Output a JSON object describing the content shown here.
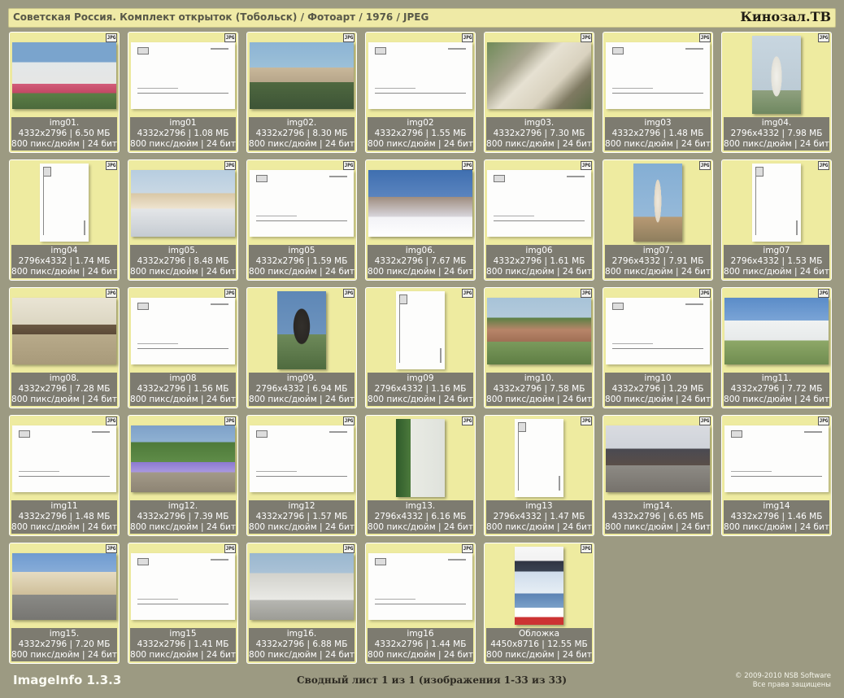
{
  "header": {
    "title": "Советская Россия. Комплект открыток (Тобольск) / Фотоарт / 1976 / JPEG",
    "brand": "Кинозал.ТВ"
  },
  "badge_label": "JPG",
  "tiles": [
    {
      "name": "img01.",
      "dims": "4332x2796 | 6.50 МБ",
      "dpi": "800 пикс/дюйм | 24 бит",
      "orientation": "land",
      "kind": "photo",
      "style": "p-img01"
    },
    {
      "name": "img01",
      "dims": "4332x2796 | 1.08 МБ",
      "dpi": "800 пикс/дюйм | 24 бит",
      "orientation": "land",
      "kind": "back",
      "style": ""
    },
    {
      "name": "img02.",
      "dims": "4332x2796 | 8.30 МБ",
      "dpi": "800 пикс/дюйм | 24 бит",
      "orientation": "land",
      "kind": "photo",
      "style": "p-img02"
    },
    {
      "name": "img02",
      "dims": "4332x2796 | 1.55 МБ",
      "dpi": "800 пикс/дюйм | 24 бит",
      "orientation": "land",
      "kind": "back",
      "style": ""
    },
    {
      "name": "img03.",
      "dims": "4332x2796 | 7.30 МБ",
      "dpi": "800 пикс/дюйм | 24 бит",
      "orientation": "land",
      "kind": "photo",
      "style": "p-img03"
    },
    {
      "name": "img03",
      "dims": "4332x2796 | 1.48 МБ",
      "dpi": "800 пикс/дюйм | 24 бит",
      "orientation": "land",
      "kind": "back",
      "style": ""
    },
    {
      "name": "img04.",
      "dims": "2796x4332 | 7.98 МБ",
      "dpi": "800 пикс/дюйм | 24 бит",
      "orientation": "port",
      "kind": "photo",
      "style": "p-img04"
    },
    {
      "name": "img04",
      "dims": "2796x4332 | 1.74 МБ",
      "dpi": "800 пикс/дюйм | 24 бит",
      "orientation": "port",
      "kind": "back",
      "style": ""
    },
    {
      "name": "img05.",
      "dims": "4332x2796 | 8.48 МБ",
      "dpi": "800 пикс/дюйм | 24 бит",
      "orientation": "land",
      "kind": "photo",
      "style": "p-img05"
    },
    {
      "name": "img05",
      "dims": "4332x2796 | 1.59 МБ",
      "dpi": "800 пикс/дюйм | 24 бит",
      "orientation": "land",
      "kind": "back",
      "style": ""
    },
    {
      "name": "img06.",
      "dims": "4332x2796 | 7.67 МБ",
      "dpi": "800 пикс/дюйм | 24 бит",
      "orientation": "land",
      "kind": "photo",
      "style": "p-img06"
    },
    {
      "name": "img06",
      "dims": "4332x2796 | 1.61 МБ",
      "dpi": "800 пикс/дюйм | 24 бит",
      "orientation": "land",
      "kind": "back",
      "style": ""
    },
    {
      "name": "img07.",
      "dims": "2796x4332 | 7.91 МБ",
      "dpi": "800 пикс/дюйм | 24 бит",
      "orientation": "port",
      "kind": "photo",
      "style": "p-img07"
    },
    {
      "name": "img07",
      "dims": "2796x4332 | 1.53 МБ",
      "dpi": "800 пикс/дюйм | 24 бит",
      "orientation": "port",
      "kind": "back",
      "style": ""
    },
    {
      "name": "img08.",
      "dims": "4332x2796 | 7.28 МБ",
      "dpi": "800 пикс/дюйм | 24 бит",
      "orientation": "land",
      "kind": "photo",
      "style": "p-img08"
    },
    {
      "name": "img08",
      "dims": "4332x2796 | 1.56 МБ",
      "dpi": "800 пикс/дюйм | 24 бит",
      "orientation": "land",
      "kind": "back",
      "style": ""
    },
    {
      "name": "img09.",
      "dims": "2796x4332 | 6.94 МБ",
      "dpi": "800 пикс/дюйм | 24 бит",
      "orientation": "port",
      "kind": "photo",
      "style": "p-img09"
    },
    {
      "name": "img09",
      "dims": "2796x4332 | 1.16 МБ",
      "dpi": "800 пикс/дюйм | 24 бит",
      "orientation": "port",
      "kind": "back",
      "style": ""
    },
    {
      "name": "img10.",
      "dims": "4332x2796 | 7.58 МБ",
      "dpi": "800 пикс/дюйм | 24 бит",
      "orientation": "land",
      "kind": "photo",
      "style": "p-img10"
    },
    {
      "name": "img10",
      "dims": "4332x2796 | 1.29 МБ",
      "dpi": "800 пикс/дюйм | 24 бит",
      "orientation": "land",
      "kind": "back",
      "style": ""
    },
    {
      "name": "img11.",
      "dims": "4332x2796 | 7.72 МБ",
      "dpi": "800 пикс/дюйм | 24 бит",
      "orientation": "land",
      "kind": "photo",
      "style": "p-img11"
    },
    {
      "name": "img11",
      "dims": "4332x2796 | 1.48 МБ",
      "dpi": "800 пикс/дюйм | 24 бит",
      "orientation": "land",
      "kind": "back",
      "style": ""
    },
    {
      "name": "img12.",
      "dims": "4332x2796 | 7.39 МБ",
      "dpi": "800 пикс/дюйм | 24 бит",
      "orientation": "land",
      "kind": "photo",
      "style": "p-img12"
    },
    {
      "name": "img12",
      "dims": "4332x2796 | 1.57 МБ",
      "dpi": "800 пикс/дюйм | 24 бит",
      "orientation": "land",
      "kind": "back",
      "style": ""
    },
    {
      "name": "img13.",
      "dims": "2796x4332 | 6.16 МБ",
      "dpi": "800 пикс/дюйм | 24 бит",
      "orientation": "port",
      "kind": "photo",
      "style": "p-img13"
    },
    {
      "name": "img13",
      "dims": "2796x4332 | 1.47 МБ",
      "dpi": "800 пикс/дюйм | 24 бит",
      "orientation": "port",
      "kind": "back",
      "style": ""
    },
    {
      "name": "img14.",
      "dims": "4332x2796 | 6.65 МБ",
      "dpi": "800 пикс/дюйм | 24 бит",
      "orientation": "land",
      "kind": "photo",
      "style": "p-img14"
    },
    {
      "name": "img14",
      "dims": "4332x2796 | 1.46 МБ",
      "dpi": "800 пикс/дюйм | 24 бит",
      "orientation": "land",
      "kind": "back",
      "style": ""
    },
    {
      "name": "img15.",
      "dims": "4332x2796 | 7.20 МБ",
      "dpi": "800 пикс/дюйм | 24 бит",
      "orientation": "land",
      "kind": "photo",
      "style": "p-img15"
    },
    {
      "name": "img15",
      "dims": "4332x2796 | 1.41 МБ",
      "dpi": "800 пикс/дюйм | 24 бит",
      "orientation": "land",
      "kind": "back",
      "style": ""
    },
    {
      "name": "img16.",
      "dims": "4332x2796 | 6.88 МБ",
      "dpi": "800 пикс/дюйм | 24 бит",
      "orientation": "land",
      "kind": "photo",
      "style": "p-img16"
    },
    {
      "name": "img16",
      "dims": "4332x2796 | 1.44 МБ",
      "dpi": "800 пикс/дюйм | 24 бит",
      "orientation": "land",
      "kind": "back",
      "style": ""
    },
    {
      "name": "Обложка",
      "dims": "4450x8716 | 12.55 МБ",
      "dpi": "800 пикс/дюйм | 24 бит",
      "orientation": "port",
      "kind": "photo",
      "style": "p-cover"
    }
  ],
  "footer": {
    "brand": "ImageInfo 1.3.3",
    "summary": "Сводный лист 1 из 1 (изображения 1-33 из 33)",
    "copyright": "© 2009-2010 NSB Software",
    "rights": "Все права защищены"
  }
}
